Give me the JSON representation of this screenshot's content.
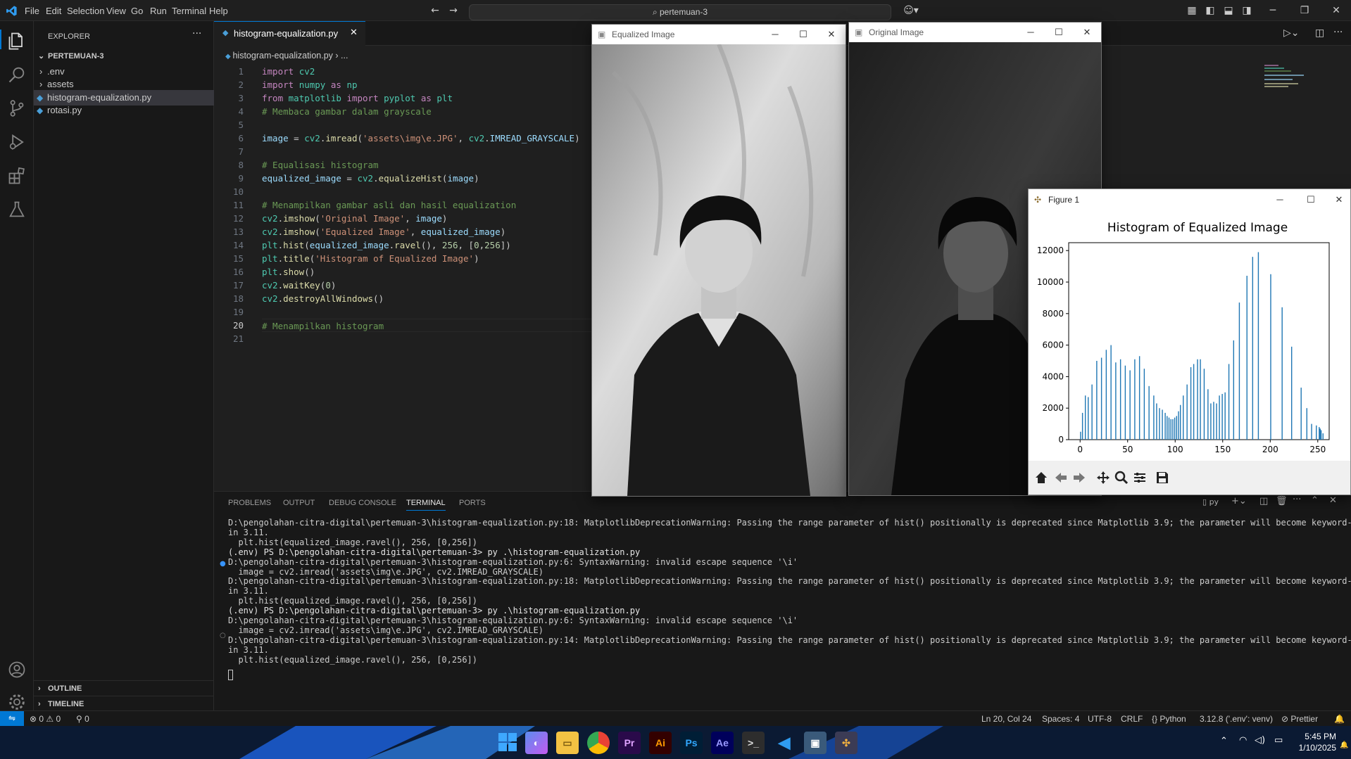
{
  "titlebar": {
    "menu": [
      "File",
      "Edit",
      "Selection",
      "View",
      "Go",
      "Run",
      "Terminal",
      "Help"
    ],
    "search": "pertemuan-3"
  },
  "sidebar": {
    "header": "EXPLORER",
    "folder": "PERTEMUAN-3",
    "items": [
      ".env",
      "assets",
      "histogram-equalization.py",
      "rotasi.py"
    ],
    "outline": "OUTLINE",
    "timeline": "TIMELINE"
  },
  "editor": {
    "tab": "histogram-equalization.py",
    "breadcrumb_file": "histogram-equalization.py",
    "breadcrumb_rest": "...",
    "lines": [
      "1",
      "2",
      "3",
      "4",
      "5",
      "6",
      "7",
      "8",
      "9",
      "10",
      "11",
      "12",
      "13",
      "14",
      "15",
      "16",
      "17",
      "18",
      "19",
      "20",
      "21"
    ]
  },
  "windows": {
    "equalized": "Equalized Image",
    "original": "Original Image",
    "figure": "Figure 1"
  },
  "chart_data": {
    "type": "bar",
    "title": "Histogram of Equalized Image",
    "xlabel": "",
    "ylabel": "",
    "xlim": [
      -12,
      262
    ],
    "ylim": [
      0,
      12500
    ],
    "xticks": [
      0,
      50,
      100,
      150,
      200,
      250
    ],
    "yticks": [
      0,
      2000,
      4000,
      6000,
      8000,
      10000,
      12000
    ],
    "color": "#1f77b4",
    "x": [
      0,
      2,
      5,
      8,
      12,
      17,
      22,
      27,
      32,
      37,
      42,
      47,
      52,
      57,
      62,
      67,
      72,
      77,
      80,
      83,
      86,
      89,
      91,
      93,
      95,
      97,
      99,
      101,
      103,
      105,
      108,
      112,
      116,
      119,
      123,
      126,
      130,
      134,
      137,
      140,
      143,
      146,
      149,
      152,
      156,
      161,
      167,
      175,
      181,
      187,
      200,
      212,
      222,
      232,
      238,
      243,
      248,
      251,
      252,
      253,
      255
    ],
    "values": [
      500,
      1700,
      2800,
      2700,
      3500,
      5000,
      5200,
      5700,
      6000,
      4900,
      5100,
      4700,
      4400,
      5100,
      5300,
      4500,
      3400,
      2800,
      2300,
      2000,
      1900,
      1700,
      1500,
      1400,
      1300,
      1300,
      1400,
      1500,
      1800,
      2200,
      2800,
      3500,
      4600,
      4800,
      5100,
      5100,
      4500,
      3200,
      2300,
      2400,
      2300,
      2800,
      2900,
      3000,
      4800,
      6300,
      8700,
      10400,
      11600,
      11900,
      10500,
      8400,
      5900,
      3300,
      2000,
      1000,
      900,
      800,
      700,
      600,
      400
    ]
  },
  "figure_toolbar": [
    "home-icon",
    "back-icon",
    "forward-icon",
    "pan-icon",
    "zoom-icon",
    "configure-icon",
    "save-icon"
  ],
  "panel": {
    "tabs": [
      "PROBLEMS",
      "OUTPUT",
      "DEBUG CONSOLE",
      "TERMINAL",
      "PORTS"
    ],
    "shell": "py",
    "terminal": [
      "D:\\pengolahan-citra-digital\\pertemuan-3\\histogram-equalization.py:18: MatplotlibDeprecationWarning: Passing the range parameter of hist() positionally is deprecated since Matplotlib 3.9; the parameter will become keyword-only",
      "in 3.11.",
      "  plt.hist(equalized_image.ravel(), 256, [0,256])",
      "(.env) PS D:\\pengolahan-citra-digital\\pertemuan-3> py .\\histogram-equalization.py",
      "D:\\pengolahan-citra-digital\\pertemuan-3\\histogram-equalization.py:6: SyntaxWarning: invalid escape sequence '\\i'",
      "  image = cv2.imread('assets\\img\\e.JPG', cv2.IMREAD_GRAYSCALE)",
      "D:\\pengolahan-citra-digital\\pertemuan-3\\histogram-equalization.py:18: MatplotlibDeprecationWarning: Passing the range parameter of hist() positionally is deprecated since Matplotlib 3.9; the parameter will become keyword-only",
      "in 3.11.",
      "  plt.hist(equalized_image.ravel(), 256, [0,256])",
      "(.env) PS D:\\pengolahan-citra-digital\\pertemuan-3> py .\\histogram-equalization.py",
      "D:\\pengolahan-citra-digital\\pertemuan-3\\histogram-equalization.py:6: SyntaxWarning: invalid escape sequence '\\i'",
      "  image = cv2.imread('assets\\img\\e.JPG', cv2.IMREAD_GRAYSCALE)",
      "D:\\pengolahan-citra-digital\\pertemuan-3\\histogram-equalization.py:14: MatplotlibDeprecationWarning: Passing the range parameter of hist() positionally is deprecated since Matplotlib 3.9; the parameter will become keyword-only",
      "in 3.11.",
      "  plt.hist(equalized_image.ravel(), 256, [0,256])"
    ]
  },
  "statusbar": {
    "errors": "0",
    "warnings": "0",
    "ports": "0",
    "position": "Ln 20, Col 24",
    "spaces": "Spaces: 4",
    "encoding": "UTF-8",
    "eol": "CRLF",
    "language": "Python",
    "interpreter": "3.12.8 ('.env': venv)",
    "formatter": "Prettier"
  },
  "taskbar": {
    "time": "5:45 PM",
    "date": "1/10/2025",
    "apps": [
      "Pr",
      "Ai",
      "Ps",
      "Ae"
    ]
  }
}
